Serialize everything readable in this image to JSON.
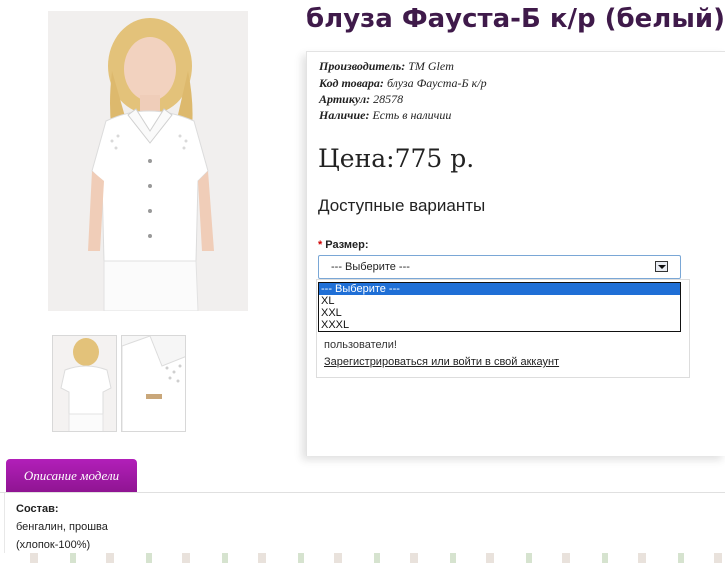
{
  "product": {
    "title": "блуза Фауста-Б к/р (белый)",
    "manufacturer_label": "Производитель:",
    "manufacturer": "ТМ Glem",
    "code_label": "Код товара:",
    "code": "блуза Фауста-Б к/р",
    "sku_label": "Артикул:",
    "sku": "28578",
    "availability_label": "Наличие:",
    "availability": "Есть в наличии",
    "price": "Цена:775 р."
  },
  "options": {
    "heading": "Доступные варианты",
    "size_label": "Размер:",
    "required_mark": "*",
    "size_select_value": "--- Выберите ---",
    "dropdown": [
      "--- Выберите ---",
      "XL",
      "XXL",
      "XXXL"
    ]
  },
  "notice": {
    "text": "пользователи!",
    "link": "Зарегистрироваться или войти в свой аккаунт"
  },
  "description": {
    "tab": "Описание модели",
    "composition_label": "Состав:",
    "composition_line1": "бенгалин, прошва",
    "composition_line2": "(хлопок-100%)"
  },
  "colors": {
    "title": "#3f1a4a",
    "tab": "#a11aa8",
    "selected_option": "#1f6fd6"
  }
}
